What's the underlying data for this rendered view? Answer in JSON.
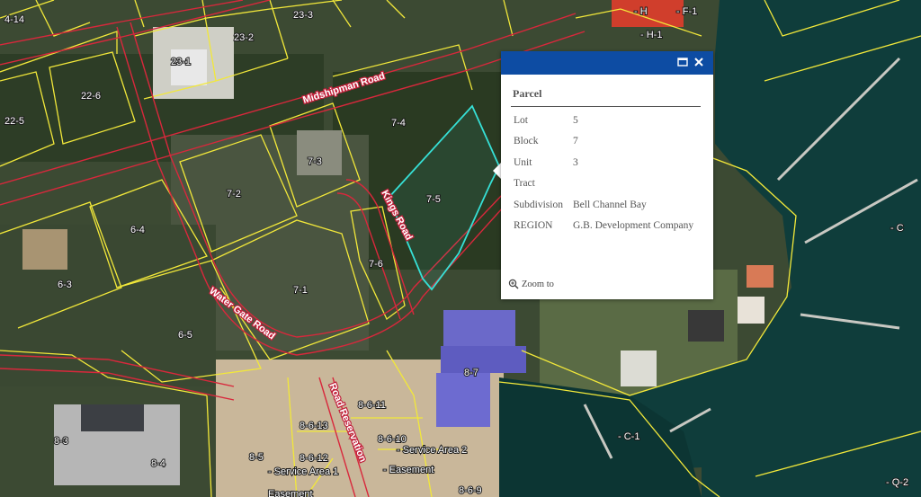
{
  "map": {
    "road_labels": [
      "Midshipman Road",
      "Kings Road",
      "Water Gate Road",
      "Road Reservation"
    ],
    "parcel_labels": [
      "4-14",
      "23-3",
      "23-2",
      "23-1",
      "22-6",
      "22-5",
      "7-4",
      "7-3",
      "7-2",
      "7-5",
      "6-4",
      "7-6",
      "6-3",
      "7-1",
      "6-5",
      "8-7",
      "8-6-11",
      "8-3",
      "8-6-13",
      "8-6-10",
      "8-4",
      "8-5",
      "8-6-12",
      "- Service Area 2",
      "- Service Area 1",
      "- Easement",
      "Easement",
      "8-6-9",
      "- C-1",
      "- Q-2",
      "- C",
      "- H",
      "- F-1",
      "- H-1"
    ],
    "colors": {
      "parcel_line": "#f2e83a",
      "road_line": "#d8283c",
      "selection": "#36e0d6"
    }
  },
  "popup": {
    "title": "Parcel",
    "maximize_icon": "maximize-icon",
    "close_icon": "close-icon",
    "fields": [
      {
        "key": "Lot",
        "value": "5"
      },
      {
        "key": "Block",
        "value": "7"
      },
      {
        "key": "Unit",
        "value": "3"
      },
      {
        "key": "Tract",
        "value": ""
      },
      {
        "key": "Subdivision",
        "value": "Bell Channel Bay"
      },
      {
        "key": "REGION",
        "value": "G.B. Development Company"
      }
    ],
    "zoom_label": "Zoom to",
    "zoom_icon": "zoom-in-icon",
    "header_color": "#0d4ca3"
  }
}
